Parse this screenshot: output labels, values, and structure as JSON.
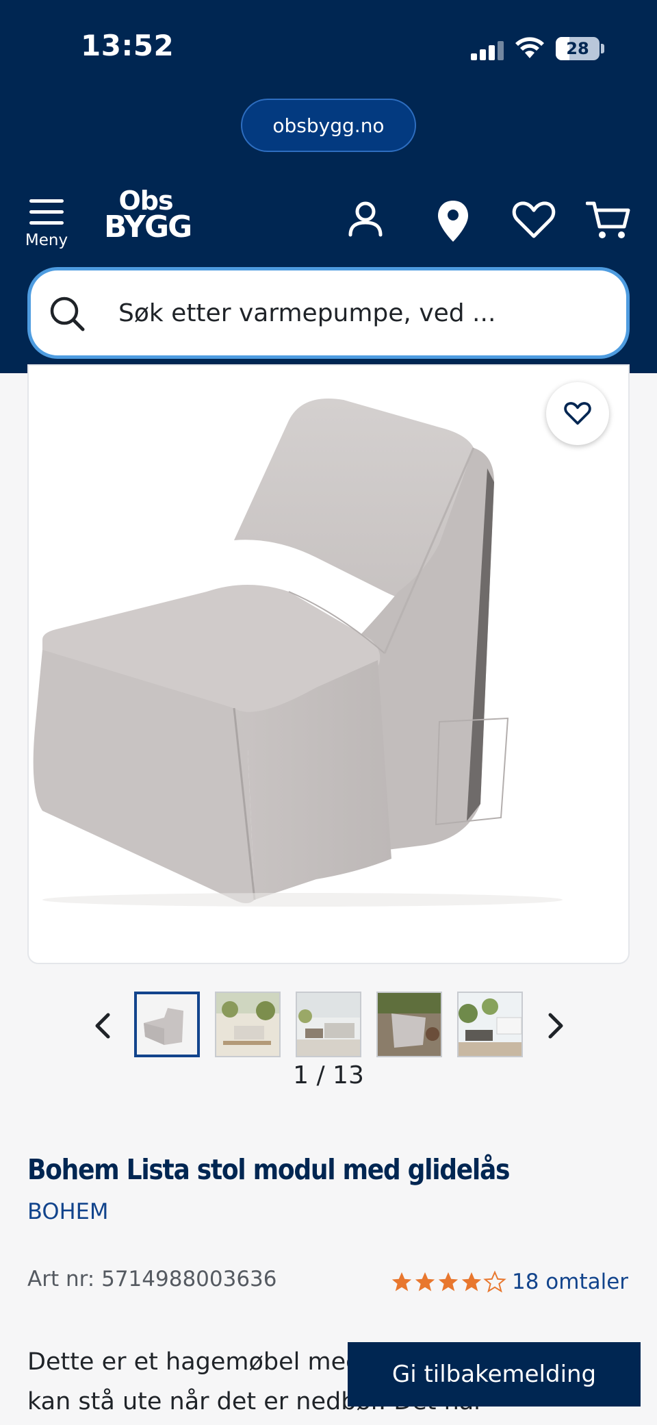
{
  "status": {
    "time": "13:52",
    "battery": "28"
  },
  "browser": {
    "url": "obsbygg.no"
  },
  "header": {
    "menu_label": "Meny",
    "logo_line1": "Obs",
    "logo_line2": "BYGG",
    "icons": [
      "user-icon",
      "location-pin-icon",
      "heart-icon",
      "cart-icon"
    ]
  },
  "search": {
    "placeholder": "Søk etter varmepumpe, ved ..."
  },
  "gallery": {
    "counter": "1 / 13",
    "current_index": 1,
    "total": 13,
    "visible_thumbnails": 5
  },
  "product": {
    "title": "Bohem Lista stol modul med glidelås",
    "brand": "BOHEM",
    "art_nr": "Art nr: 5714988003636",
    "rating": 4.5,
    "rating_max": 5,
    "reviews": "18 omtaler",
    "description": "Dette er et hagemøbel med glidelås, og denne kan stå ute når det er nedbør. Det har"
  },
  "feedback": {
    "label": "Gi tilbakemelding"
  },
  "colors": {
    "header_bg": "#002652",
    "accent_blue": "#12448c",
    "search_border": "#4e9ce0",
    "star": "#e8772e"
  }
}
